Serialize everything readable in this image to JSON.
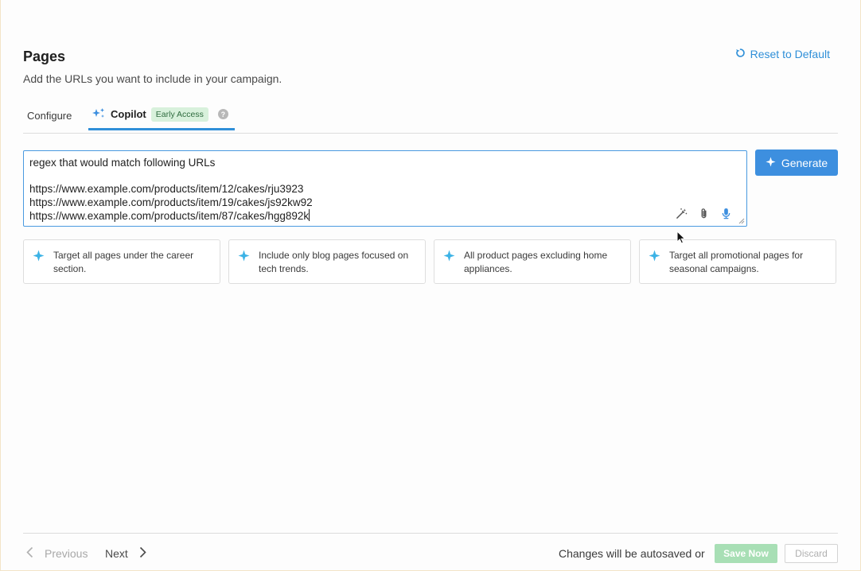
{
  "header": {
    "title": "Pages",
    "subtitle": "Add the URLs you want to include in your campaign.",
    "reset_label": "Reset to Default"
  },
  "tabs": [
    {
      "label": "Configure",
      "active": false
    },
    {
      "label": "Copilot",
      "active": true,
      "badge": "Early Access",
      "help": "?"
    }
  ],
  "prompt": {
    "text": "regex that would match following URLs\n\nhttps://www.example.com/products/item/12/cakes/rju3923\nhttps://www.example.com/products/item/19/cakes/js92kw92\nhttps://www.example.com/products/item/87/cakes/hgg892k",
    "tools": [
      "magic-wand-icon",
      "paperclip-icon",
      "microphone-icon"
    ]
  },
  "generate_label": "Generate",
  "suggestions": [
    {
      "text": "Target all pages under the career section."
    },
    {
      "text": "Include only blog pages focused on tech trends."
    },
    {
      "text": "All product pages excluding home appliances."
    },
    {
      "text": "Target all promotional pages for seasonal campaigns."
    }
  ],
  "footer": {
    "previous_label": "Previous",
    "next_label": "Next",
    "autosave_text": "Changes will be autosaved or",
    "save_label": "Save Now",
    "discard_label": "Discard"
  },
  "colors": {
    "accent": "#3d8fdf",
    "badge_bg": "#d8f1dc",
    "save_disabled": "#a8dfb5",
    "sparkle": "#3db3e6"
  }
}
